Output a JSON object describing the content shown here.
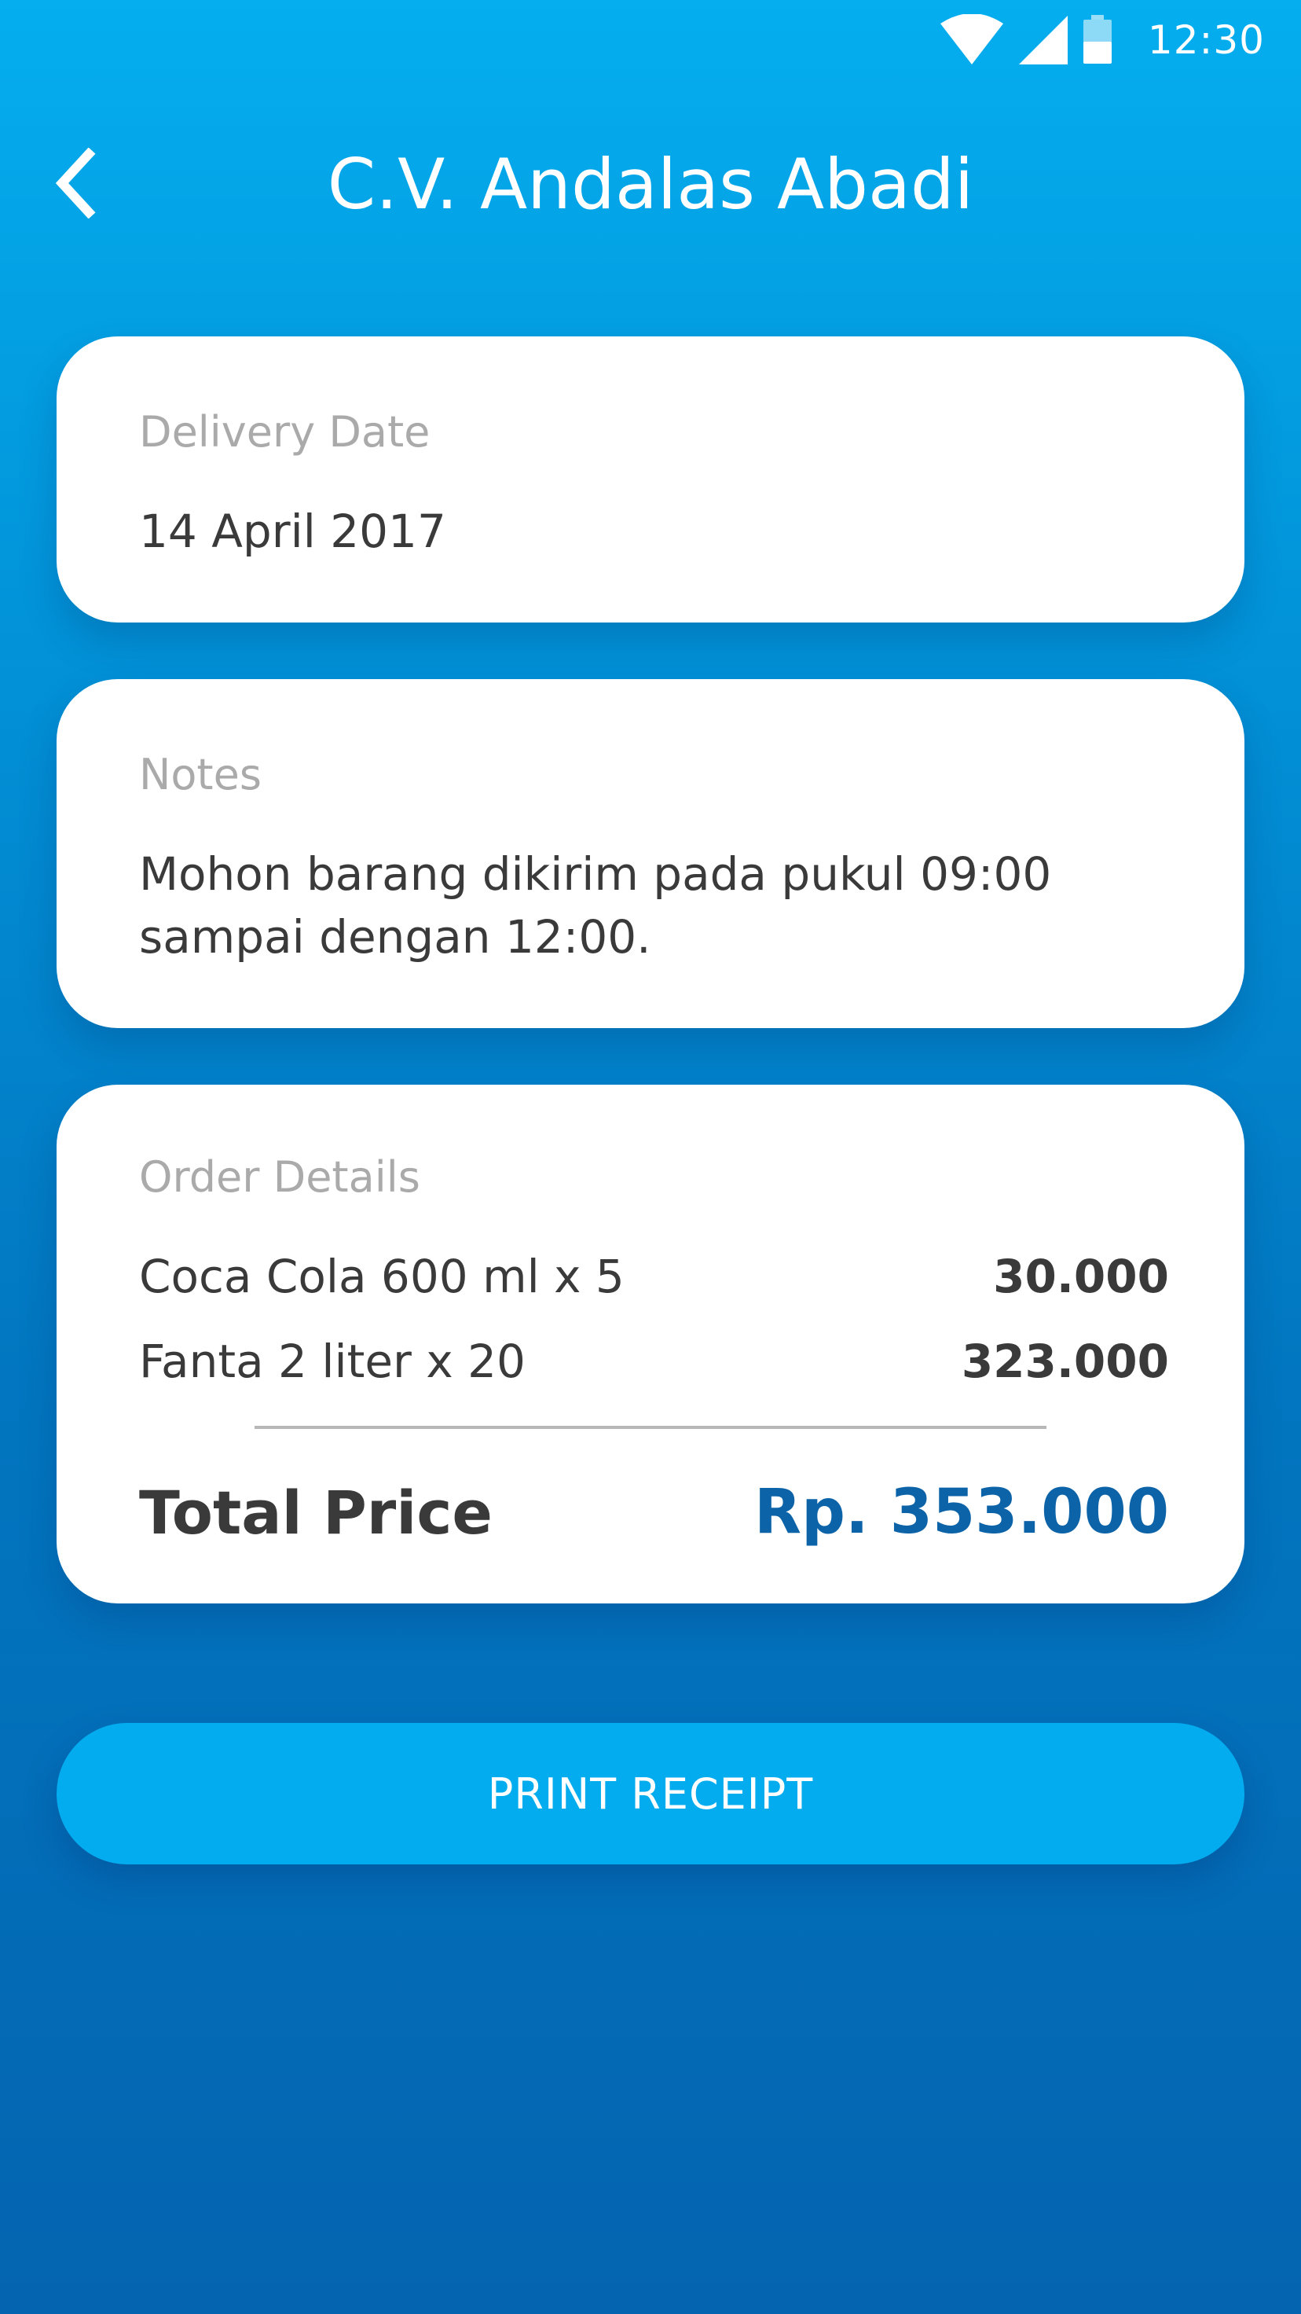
{
  "status_bar": {
    "time": "12:30",
    "icons": [
      "wifi-icon",
      "cellular-signal-icon",
      "battery-icon"
    ]
  },
  "header": {
    "title": "C.V. Andalas Abadi",
    "back_icon": "chevron-left-icon"
  },
  "delivery": {
    "label": "Delivery Date",
    "value": "14 April 2017"
  },
  "notes": {
    "label": "Notes",
    "text": "Mohon barang dikirim pada pukul 09:00 sampai dengan 12:00."
  },
  "order": {
    "label": "Order Details",
    "items": [
      {
        "name": "Coca Cola 600 ml x 5",
        "price": "30.000"
      },
      {
        "name": "Fanta 2 liter x 20",
        "price": "323.000"
      }
    ],
    "total_label": "Total Price",
    "total_value": "Rp. 353.000"
  },
  "actions": {
    "print_label": "PRINT RECEIPT"
  },
  "colors": {
    "background_top": "#04aeef",
    "background_bottom": "#0464b0",
    "accent_total": "#0d63a8",
    "button": "#03acee"
  }
}
